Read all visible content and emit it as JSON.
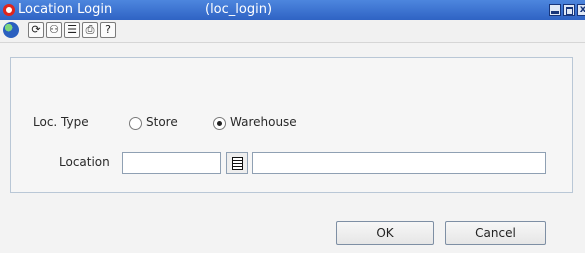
{
  "window": {
    "title": "Location Login",
    "code": "(loc_login)",
    "close_glyph": "x"
  },
  "toolbar": {
    "icons": [
      "globe-icon",
      "refresh-icon",
      "binoculars-icon",
      "notes-icon",
      "print-icon",
      "help-icon"
    ],
    "glyphs": {
      "refresh": "⟳",
      "binoculars": "⚇",
      "notes": "☰",
      "print": "⎙",
      "help": "?"
    }
  },
  "form": {
    "loc_type_label": "Loc. Type",
    "options": [
      {
        "label": "Store",
        "selected": false
      },
      {
        "label": "Warehouse",
        "selected": true
      }
    ],
    "location_label": "Location",
    "location_value": "",
    "location_desc_value": ""
  },
  "buttons": {
    "ok": "OK",
    "cancel": "Cancel"
  },
  "colors": {
    "title_bar": "#3d74d2",
    "oracle_red": "#e0251b",
    "panel_border": "#b9c7d6"
  }
}
